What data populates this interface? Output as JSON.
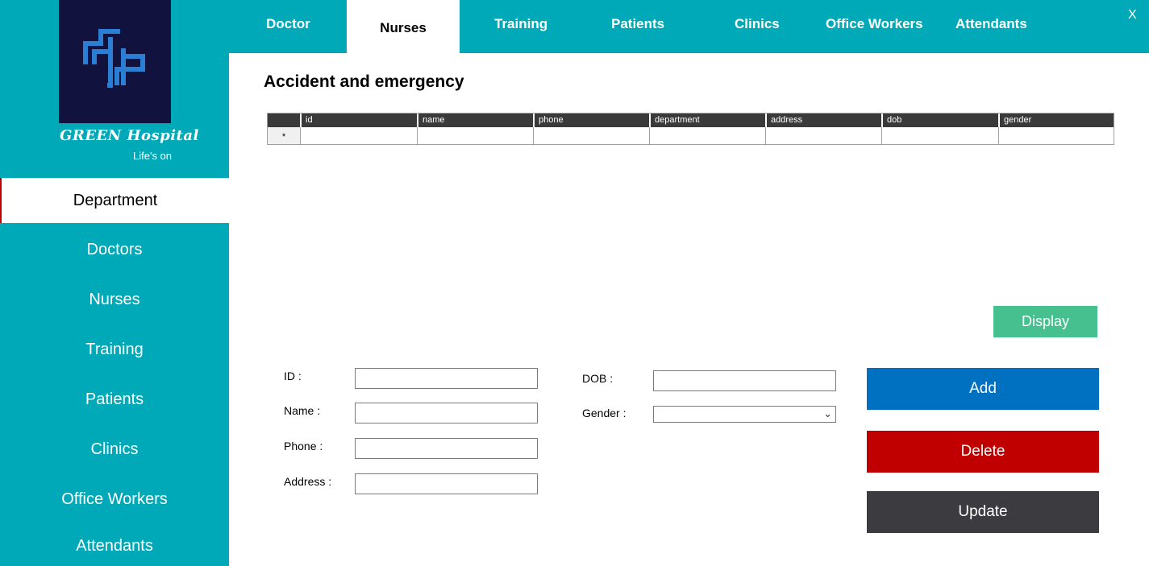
{
  "brand": {
    "name": "GREEN Hospital",
    "tagline": "Life's on"
  },
  "sidebar": {
    "items": [
      {
        "label": "Department",
        "active": true
      },
      {
        "label": "Doctors"
      },
      {
        "label": "Nurses"
      },
      {
        "label": "Training"
      },
      {
        "label": "Patients"
      },
      {
        "label": "Clinics"
      },
      {
        "label": "Office Workers"
      },
      {
        "label": "Attendants"
      }
    ]
  },
  "tabs": [
    {
      "label": "Doctor"
    },
    {
      "label": "Nurses",
      "active": true
    },
    {
      "label": "Training"
    },
    {
      "label": "Patients"
    },
    {
      "label": "Clinics"
    },
    {
      "label": "Office Workers"
    },
    {
      "label": "Attendants"
    }
  ],
  "close_label": "X",
  "main": {
    "title": "Accident and emergency",
    "table": {
      "columns": [
        "id",
        "name",
        "phone",
        "department",
        "address",
        "dob",
        "gender"
      ],
      "new_row_marker": "*",
      "rows": []
    },
    "display_label": "Display"
  },
  "form": {
    "id_label": "ID :",
    "name_label": "Name :",
    "phone_label": "Phone :",
    "address_label": "Address :",
    "dob_label": "DOB :",
    "gender_label": "Gender :",
    "id_value": "",
    "name_value": "",
    "phone_value": "",
    "address_value": "",
    "dob_value": "",
    "gender_value": ""
  },
  "actions": {
    "add_label": "Add",
    "delete_label": "Delete",
    "update_label": "Update"
  },
  "colors": {
    "teal": "#00a9b7",
    "navy": "#12123f",
    "logo_blue": "#2a7fd4",
    "display_green": "#47c08f",
    "add_blue": "#0070c0",
    "delete_red": "#c00000",
    "update_gray": "#3c3c40"
  }
}
